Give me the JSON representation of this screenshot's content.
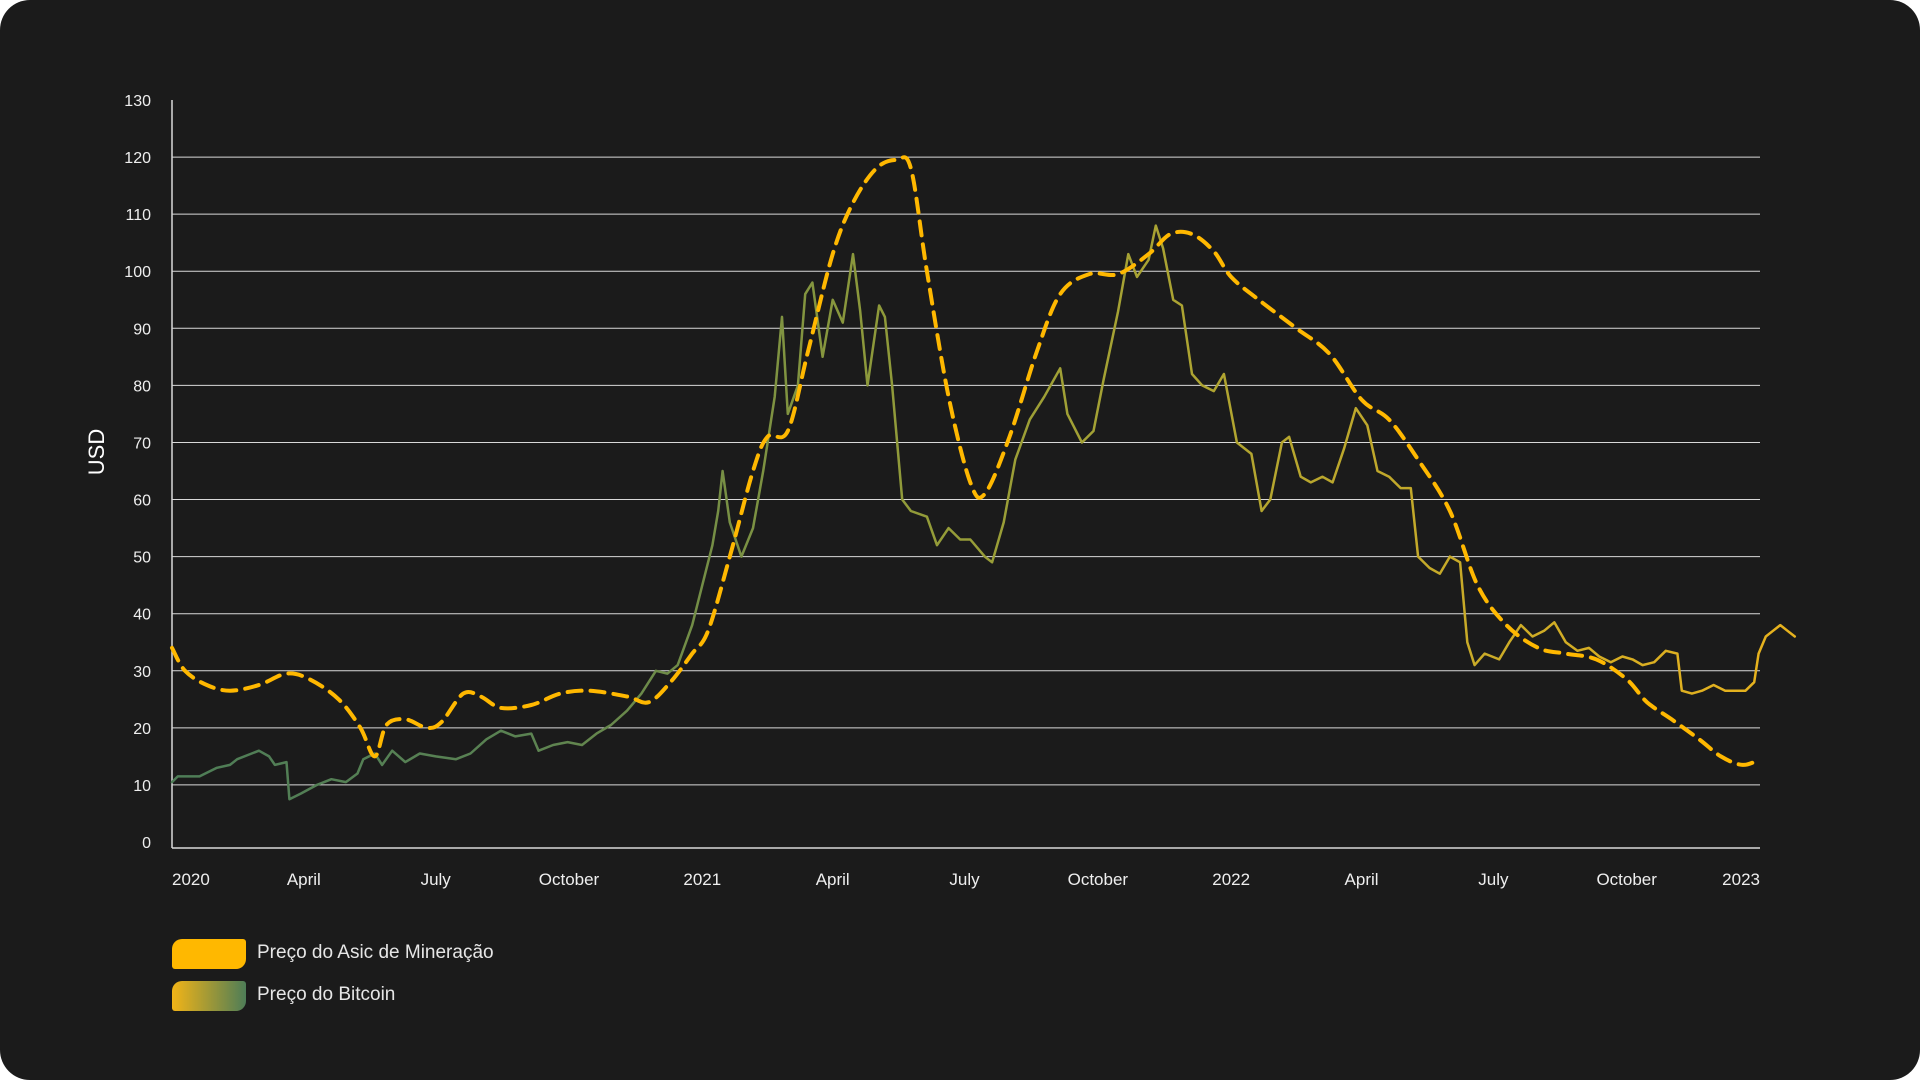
{
  "colors": {
    "background": "#1b1b1b",
    "grid": "#d9d9d9",
    "text": "#eeeeee",
    "asic": "#ffb800",
    "bitcoin_green": "#4e7d57",
    "bitcoin_olive": "#8f9a3a",
    "bitcoin_yellow": "#e0b024"
  },
  "chart_data": {
    "type": "line",
    "title": "",
    "ylabel": "USD",
    "xlabel": "",
    "ylim": [
      0,
      130
    ],
    "yticks": [
      0,
      10,
      20,
      30,
      40,
      50,
      60,
      70,
      80,
      90,
      100,
      110,
      120,
      130
    ],
    "xlim": [
      "2020-01-01",
      "2023-01-01"
    ],
    "xticks": [
      {
        "date": "2020-01-01",
        "label": "2020"
      },
      {
        "date": "2020-04-01",
        "label": "April"
      },
      {
        "date": "2020-07-01",
        "label": "July"
      },
      {
        "date": "2020-10-01",
        "label": "October"
      },
      {
        "date": "2021-01-01",
        "label": "2021"
      },
      {
        "date": "2021-04-01",
        "label": "April"
      },
      {
        "date": "2021-07-01",
        "label": "July"
      },
      {
        "date": "2021-10-01",
        "label": "October"
      },
      {
        "date": "2022-01-01",
        "label": "2022"
      },
      {
        "date": "2022-04-01",
        "label": "April"
      },
      {
        "date": "2022-07-01",
        "label": "July"
      },
      {
        "date": "2022-10-01",
        "label": "October"
      },
      {
        "date": "2023-01-01",
        "label": "2023"
      }
    ],
    "grid": "horizontal",
    "legend_position": "bottom-left",
    "series": [
      {
        "name": "Preço do Asic de Mineração",
        "style": "dashed",
        "points": [
          [
            "2020-01-01",
            34
          ],
          [
            "2020-01-10",
            30
          ],
          [
            "2020-01-25",
            27.5
          ],
          [
            "2020-02-10",
            26.5
          ],
          [
            "2020-03-01",
            27.5
          ],
          [
            "2020-03-20",
            29.5
          ],
          [
            "2020-04-05",
            28.5
          ],
          [
            "2020-04-25",
            25
          ],
          [
            "2020-05-10",
            20
          ],
          [
            "2020-05-20",
            15
          ],
          [
            "2020-05-28",
            20.5
          ],
          [
            "2020-06-10",
            21.5
          ],
          [
            "2020-06-25",
            20
          ],
          [
            "2020-07-05",
            21
          ],
          [
            "2020-07-20",
            26
          ],
          [
            "2020-08-01",
            25.5
          ],
          [
            "2020-08-15",
            23.5
          ],
          [
            "2020-09-05",
            24
          ],
          [
            "2020-09-25",
            26
          ],
          [
            "2020-10-15",
            26.5
          ],
          [
            "2020-11-10",
            25.5
          ],
          [
            "2020-11-25",
            24.5
          ],
          [
            "2020-12-10",
            28
          ],
          [
            "2020-12-25",
            33
          ],
          [
            "2021-01-05",
            37
          ],
          [
            "2021-01-20",
            50
          ],
          [
            "2021-02-05",
            65
          ],
          [
            "2021-02-15",
            71
          ],
          [
            "2021-03-01",
            72
          ],
          [
            "2021-03-15",
            86
          ],
          [
            "2021-04-01",
            103
          ],
          [
            "2021-04-15",
            112
          ],
          [
            "2021-05-01",
            118
          ],
          [
            "2021-05-15",
            119.5
          ],
          [
            "2021-05-25",
            118
          ],
          [
            "2021-06-05",
            100
          ],
          [
            "2021-06-20",
            78
          ],
          [
            "2021-07-05",
            63
          ],
          [
            "2021-07-15",
            61
          ],
          [
            "2021-08-01",
            71
          ],
          [
            "2021-08-20",
            86
          ],
          [
            "2021-09-05",
            96
          ],
          [
            "2021-09-25",
            99.5
          ],
          [
            "2021-10-15",
            99.5
          ],
          [
            "2021-11-05",
            103
          ],
          [
            "2021-11-20",
            106.5
          ],
          [
            "2021-12-05",
            106.5
          ],
          [
            "2021-12-20",
            103.5
          ],
          [
            "2022-01-01",
            99
          ],
          [
            "2022-01-20",
            95
          ],
          [
            "2022-02-15",
            90
          ],
          [
            "2022-03-10",
            85.5
          ],
          [
            "2022-04-01",
            77.5
          ],
          [
            "2022-04-20",
            74
          ],
          [
            "2022-05-10",
            67
          ],
          [
            "2022-06-01",
            58
          ],
          [
            "2022-06-20",
            45
          ],
          [
            "2022-07-10",
            38
          ],
          [
            "2022-08-01",
            34
          ],
          [
            "2022-08-20",
            33
          ],
          [
            "2022-09-10",
            32
          ],
          [
            "2022-10-01",
            28.5
          ],
          [
            "2022-10-15",
            24.5
          ],
          [
            "2022-11-01",
            21.5
          ],
          [
            "2022-11-20",
            18
          ],
          [
            "2022-12-05",
            15
          ],
          [
            "2022-12-20",
            13.5
          ],
          [
            "2023-01-01",
            14.5
          ]
        ]
      },
      {
        "name": "Preço do Bitcoin",
        "style": "solid-gradient",
        "points": [
          [
            "2020-01-01",
            10.5
          ],
          [
            "2020-01-05",
            11.5
          ],
          [
            "2020-01-20",
            11.5
          ],
          [
            "2020-02-01",
            13
          ],
          [
            "2020-02-10",
            13.5
          ],
          [
            "2020-02-15",
            14.5
          ],
          [
            "2020-02-25",
            15.5
          ],
          [
            "2020-03-01",
            16
          ],
          [
            "2020-03-08",
            15
          ],
          [
            "2020-03-12",
            13.5
          ],
          [
            "2020-03-20",
            14
          ],
          [
            "2020-03-22",
            7.5
          ],
          [
            "2020-03-30",
            8.5
          ],
          [
            "2020-04-10",
            10
          ],
          [
            "2020-04-20",
            11
          ],
          [
            "2020-04-30",
            10.5
          ],
          [
            "2020-05-08",
            12
          ],
          [
            "2020-05-12",
            14.5
          ],
          [
            "2020-05-20",
            15.5
          ],
          [
            "2020-05-25",
            13.5
          ],
          [
            "2020-06-01",
            16
          ],
          [
            "2020-06-10",
            14
          ],
          [
            "2020-06-20",
            15.5
          ],
          [
            "2020-07-01",
            15
          ],
          [
            "2020-07-15",
            14.5
          ],
          [
            "2020-07-25",
            15.5
          ],
          [
            "2020-08-05",
            18
          ],
          [
            "2020-08-15",
            19.5
          ],
          [
            "2020-08-25",
            18.5
          ],
          [
            "2020-09-05",
            19
          ],
          [
            "2020-09-10",
            16
          ],
          [
            "2020-09-20",
            17
          ],
          [
            "2020-09-30",
            17.5
          ],
          [
            "2020-10-10",
            17
          ],
          [
            "2020-10-20",
            19
          ],
          [
            "2020-10-30",
            20.5
          ],
          [
            "2020-11-10",
            23
          ],
          [
            "2020-11-20",
            26
          ],
          [
            "2020-11-30",
            30
          ],
          [
            "2020-12-08",
            29.5
          ],
          [
            "2020-12-15",
            31
          ],
          [
            "2020-12-25",
            38
          ],
          [
            "2021-01-08",
            52
          ],
          [
            "2021-01-12",
            58
          ],
          [
            "2021-01-15",
            65
          ],
          [
            "2021-01-20",
            56
          ],
          [
            "2021-01-28",
            50
          ],
          [
            "2021-02-05",
            55
          ],
          [
            "2021-02-12",
            65
          ],
          [
            "2021-02-20",
            78
          ],
          [
            "2021-02-25",
            92
          ],
          [
            "2021-03-01",
            75
          ],
          [
            "2021-03-08",
            80
          ],
          [
            "2021-03-13",
            96
          ],
          [
            "2021-03-18",
            98
          ],
          [
            "2021-03-25",
            85
          ],
          [
            "2021-04-01",
            95
          ],
          [
            "2021-04-08",
            91
          ],
          [
            "2021-04-15",
            103
          ],
          [
            "2021-04-20",
            93
          ],
          [
            "2021-04-25",
            80
          ],
          [
            "2021-05-03",
            94
          ],
          [
            "2021-05-07",
            92
          ],
          [
            "2021-05-12",
            80
          ],
          [
            "2021-05-19",
            60
          ],
          [
            "2021-05-25",
            58
          ],
          [
            "2021-06-05",
            57
          ],
          [
            "2021-06-12",
            52
          ],
          [
            "2021-06-20",
            55
          ],
          [
            "2021-06-28",
            53
          ],
          [
            "2021-07-05",
            53
          ],
          [
            "2021-07-15",
            50
          ],
          [
            "2021-07-20",
            49
          ],
          [
            "2021-07-28",
            56
          ],
          [
            "2021-08-05",
            67
          ],
          [
            "2021-08-15",
            74
          ],
          [
            "2021-08-25",
            78
          ],
          [
            "2021-09-05",
            83
          ],
          [
            "2021-09-10",
            75
          ],
          [
            "2021-09-20",
            70
          ],
          [
            "2021-09-28",
            72
          ],
          [
            "2021-10-05",
            81
          ],
          [
            "2021-10-15",
            93
          ],
          [
            "2021-10-22",
            103
          ],
          [
            "2021-10-28",
            99
          ],
          [
            "2021-11-05",
            102
          ],
          [
            "2021-11-10",
            108
          ],
          [
            "2021-11-15",
            104
          ],
          [
            "2021-11-22",
            95
          ],
          [
            "2021-11-28",
            94
          ],
          [
            "2021-12-05",
            82
          ],
          [
            "2021-12-12",
            80
          ],
          [
            "2021-12-20",
            79
          ],
          [
            "2021-12-27",
            82
          ],
          [
            "2022-01-05",
            70
          ],
          [
            "2022-01-15",
            68
          ],
          [
            "2022-01-22",
            58
          ],
          [
            "2022-01-28",
            60
          ],
          [
            "2022-02-05",
            70
          ],
          [
            "2022-02-10",
            71
          ],
          [
            "2022-02-18",
            64
          ],
          [
            "2022-02-25",
            63
          ],
          [
            "2022-03-05",
            64
          ],
          [
            "2022-03-12",
            63
          ],
          [
            "2022-03-20",
            69
          ],
          [
            "2022-03-28",
            76
          ],
          [
            "2022-04-05",
            73
          ],
          [
            "2022-04-12",
            65
          ],
          [
            "2022-04-20",
            64
          ],
          [
            "2022-04-28",
            62
          ],
          [
            "2022-05-05",
            62
          ],
          [
            "2022-05-10",
            50
          ],
          [
            "2022-05-18",
            48
          ],
          [
            "2022-05-25",
            47
          ],
          [
            "2022-06-01",
            50
          ],
          [
            "2022-06-08",
            49
          ],
          [
            "2022-06-13",
            35
          ],
          [
            "2022-06-18",
            31
          ],
          [
            "2022-06-25",
            33
          ],
          [
            "2022-07-05",
            32
          ],
          [
            "2022-07-12",
            35
          ],
          [
            "2022-07-20",
            38
          ],
          [
            "2022-07-28",
            36
          ],
          [
            "2022-08-05",
            37
          ],
          [
            "2022-08-12",
            38.5
          ],
          [
            "2022-08-20",
            35
          ],
          [
            "2022-08-28",
            33.5
          ],
          [
            "2022-09-05",
            34
          ],
          [
            "2022-09-12",
            32.5
          ],
          [
            "2022-09-20",
            31.5
          ],
          [
            "2022-09-28",
            32.5
          ],
          [
            "2022-10-05",
            32
          ],
          [
            "2022-10-12",
            31
          ],
          [
            "2022-10-20",
            31.5
          ],
          [
            "2022-10-28",
            33.5
          ],
          [
            "2022-11-05",
            33
          ],
          [
            "2022-11-08",
            26.5
          ],
          [
            "2022-11-15",
            26
          ],
          [
            "2022-11-22",
            26.5
          ],
          [
            "2022-11-30",
            27.5
          ],
          [
            "2022-12-08",
            26.5
          ],
          [
            "2022-12-15",
            26.5
          ],
          [
            "2022-12-22",
            26.5
          ],
          [
            "2022-12-28",
            28
          ],
          [
            "2022-12-31",
            33
          ],
          [
            "2023-01-05",
            36
          ],
          [
            "2023-01-10",
            37
          ],
          [
            "2023-01-15",
            38
          ],
          [
            "2023-01-20",
            37
          ],
          [
            "2023-01-25",
            36
          ]
        ]
      }
    ]
  },
  "legend": [
    {
      "label": "Preço do Asic de Mineração"
    },
    {
      "label": "Preço do Bitcoin"
    }
  ]
}
